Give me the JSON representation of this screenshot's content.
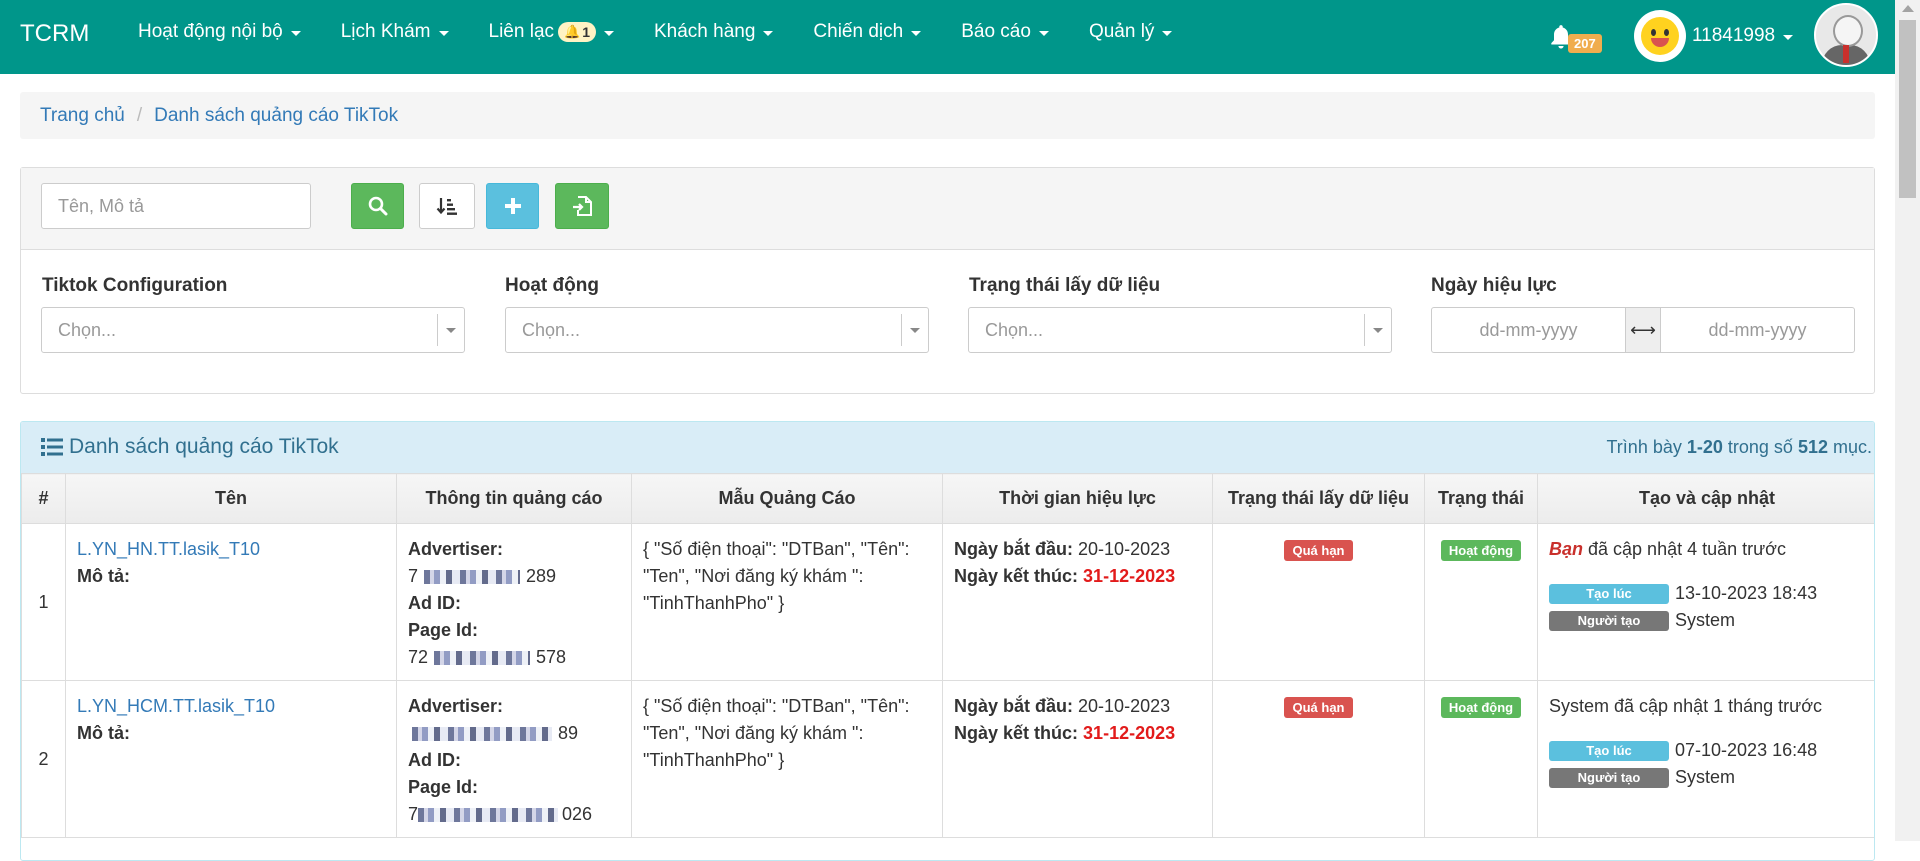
{
  "navbar": {
    "brand": "TCRM",
    "menu": [
      {
        "label": "Hoạt động nội bộ"
      },
      {
        "label": "Lịch Khám"
      },
      {
        "label": "Liên lạc",
        "badge": "1"
      },
      {
        "label": "Khách hàng"
      },
      {
        "label": "Chiến dịch"
      },
      {
        "label": "Báo cáo"
      },
      {
        "label": "Quản lý"
      }
    ],
    "notification_count": "207",
    "user_id": "11841998"
  },
  "breadcrumb": {
    "home": "Trang chủ",
    "current": "Danh sách quảng cáo TikTok"
  },
  "filters": {
    "search_placeholder": "Tên, Mô tả",
    "tiktok_config": {
      "label": "Tiktok Configuration",
      "placeholder": "Chọn..."
    },
    "activity": {
      "label": "Hoạt động",
      "placeholder": "Chọn..."
    },
    "fetch_status": {
      "label": "Trạng thái lấy dữ liệu",
      "placeholder": "Chọn..."
    },
    "effective_date": {
      "label": "Ngày hiệu lực",
      "from_placeholder": "dd-mm-yyyy",
      "to_placeholder": "dd-mm-yyyy"
    }
  },
  "table_panel": {
    "title": "Danh sách quảng cáo TikTok",
    "summary_prefix": "Trình bày ",
    "summary_range": "1-20",
    "summary_mid": " trong số ",
    "summary_total": "512",
    "summary_suffix": " mục."
  },
  "columns": [
    "#",
    "Tên",
    "Thông tin quảng cáo",
    "Mẫu Quảng Cáo",
    "Thời gian hiệu lực",
    "Trạng thái lấy dữ liệu",
    "Trạng thái",
    "Tạo và cập nhật"
  ],
  "rows": [
    {
      "index": "1",
      "name": "L.YN_HN.TT.lasik_T10",
      "desc_label": "Mô tả:",
      "advertiser_label": "Advertiser:",
      "advertiser_prefix": "7",
      "advertiser_suffix": "289",
      "ad_id_label": "Ad ID:",
      "page_id_label": "Page Id:",
      "page_id_prefix": "72",
      "page_id_suffix": "578",
      "template": "{ \"Số điện thoại\": \"DTBan\", \"Tên\": \"Ten\", \"Nơi đăng ký khám \": \"TinhThanhPho\" }",
      "start_label": "Ngày bắt đầu:",
      "start_date": "20-10-2023",
      "end_label": "Ngày kết thúc:",
      "end_date": "31-12-2023",
      "fetch_status": "Quá hạn",
      "status": "Hoạt động",
      "updated_by": "Bạn",
      "updated_text": " đã cập nhật 4 tuần trước",
      "created_label": "Tạo lúc",
      "created_at": "13-10-2023 18:43",
      "creator_label": "Người tạo",
      "creator": "System"
    },
    {
      "index": "2",
      "name": "L.YN_HCM.TT.lasik_T10",
      "desc_label": "Mô tả:",
      "advertiser_label": "Advertiser:",
      "advertiser_prefix": "",
      "advertiser_suffix": "89",
      "ad_id_label": "Ad ID:",
      "page_id_label": "Page Id:",
      "page_id_prefix": "7",
      "page_id_suffix": "026",
      "template": "{ \"Số điện thoại\": \"DTBan\", \"Tên\": \"Ten\", \"Nơi đăng ký khám \": \"TinhThanhPho\" }",
      "start_label": "Ngày bắt đầu:",
      "start_date": "20-10-2023",
      "end_label": "Ngày kết thúc:",
      "end_date": "31-12-2023",
      "fetch_status": "Quá hạn",
      "status": "Hoạt động",
      "updated_by": "",
      "updated_text": "System đã cập nhật 1 tháng trước",
      "created_label": "Tạo lúc",
      "created_at": "07-10-2023 16:48",
      "creator_label": "Người tạo",
      "creator": "System"
    }
  ],
  "colors": {
    "navbar": "#00968a",
    "link": "#337ab7",
    "danger": "#d9534f",
    "success": "#5cb85c",
    "info": "#5bc0de"
  }
}
